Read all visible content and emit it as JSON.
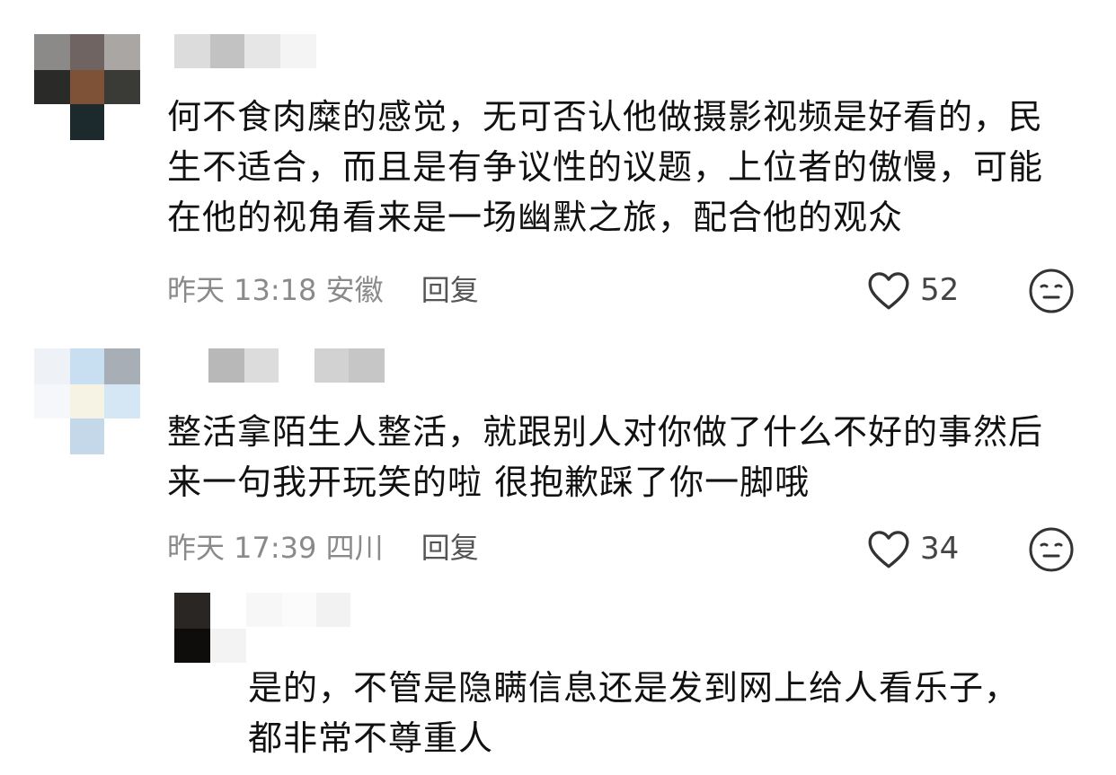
{
  "comments": [
    {
      "text_lines": [
        "何不食肉糜的感觉，无可否认他做摄影视频是好看的，民",
        "生不适合，而且是有争议性的议题，上位者的傲慢，可能",
        "在他的视角看来是一场幽默之旅，配合他的观众"
      ],
      "time": "昨天 13:18",
      "location": "安徽",
      "reply_label": "回复",
      "likes": "52"
    },
    {
      "text_lines": [
        "整活拿陌生人整活，就跟别人对你做了什么不好的事然后",
        "来一句我开玩笑的啦 很抱歉踩了你一脚哦"
      ],
      "time": "昨天 17:39",
      "location": "四川",
      "reply_label": "回复",
      "likes": "34"
    }
  ],
  "reply": {
    "text_lines": [
      "是的，不管是隐瞒信息还是发到网上给人看乐子，",
      "都非常不尊重人"
    ]
  },
  "icons": {
    "like": "heart-outline-icon",
    "emoji": "neutral-face-icon"
  },
  "colors": {
    "text": "#111111",
    "meta": "#8a8a8a",
    "icon": "#333333"
  }
}
